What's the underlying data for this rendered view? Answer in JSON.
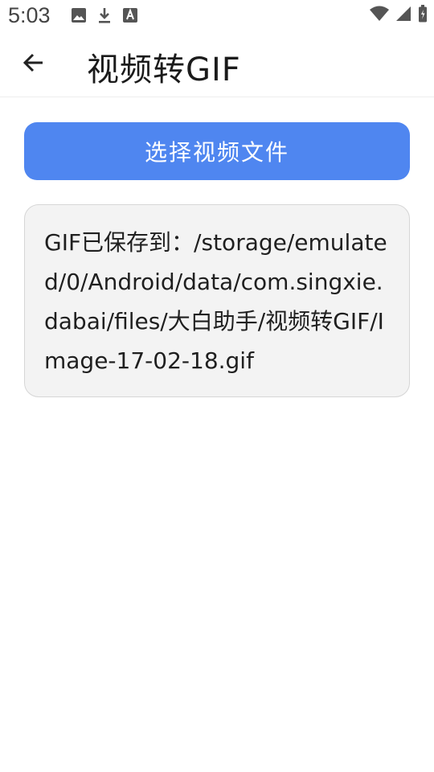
{
  "status_bar": {
    "time": "5:03",
    "left_icons": [
      "image-icon",
      "download-icon",
      "font-icon"
    ],
    "right_icons": [
      "wifi-icon",
      "signal-icon",
      "battery-icon"
    ]
  },
  "app_bar": {
    "title": "视频转GIF",
    "back_icon": "arrow-left-icon"
  },
  "main": {
    "select_button_label": "选择视频文件",
    "result_text": "GIF已保存到：/storage/emulated/0/Android/data/com.singxie.dabai/files/大白助手/视频转GIF/Image-17-02-18.gif"
  },
  "colors": {
    "accent": "#4f86f0",
    "card_bg": "#f3f3f3",
    "card_border": "#d6d6d6"
  }
}
